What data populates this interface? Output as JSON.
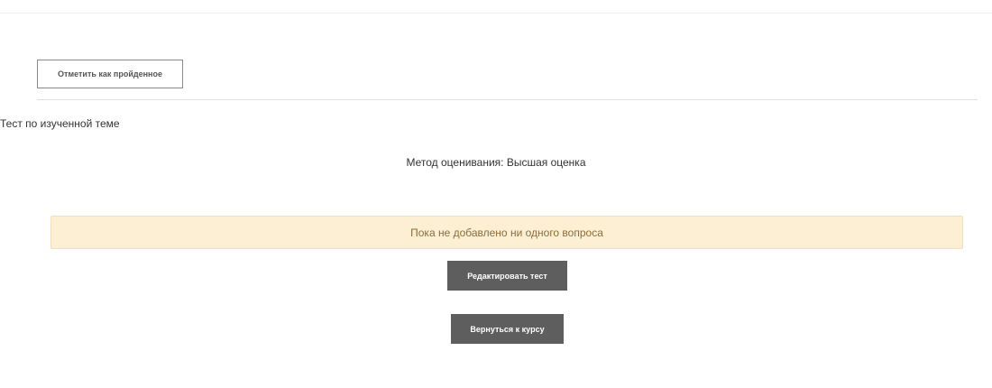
{
  "completion": {
    "mark_done_label": "Отметить как пройденное"
  },
  "quiz": {
    "title": "Тест по изученной теме",
    "grading_method": "Метод оценивания: Высшая оценка",
    "notice": "Пока не добавлено ни одного вопроса"
  },
  "actions": {
    "edit_quiz_label": "Редактировать тест",
    "back_to_course_label": "Вернуться к курсу"
  },
  "colors": {
    "notice_background": "#fcefd4",
    "button_background": "#5e5e5e"
  }
}
